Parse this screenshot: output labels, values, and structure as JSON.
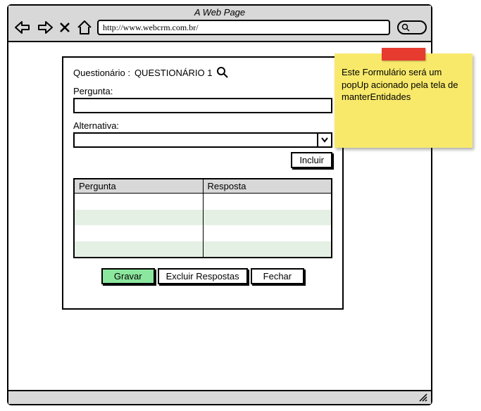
{
  "browser": {
    "page_title": "A Web Page",
    "url": "http://www.webcrm.com.br/"
  },
  "form": {
    "title_prefix": "Questionário : ",
    "title_value": "QUESTIONÁRIO 1",
    "pergunta_label": "Pergunta:",
    "pergunta_value": "",
    "alternativa_label": "Alternativa:",
    "alternativa_value": "",
    "incluir_label": "Incluir",
    "table": {
      "col1_header": "Pergunta",
      "col2_header": "Resposta",
      "rows": []
    },
    "buttons": {
      "gravar": "Gravar",
      "excluir_respostas": "Excluir Respostas",
      "fechar": "Fechar"
    }
  },
  "sticky": {
    "text": "Este Formulário será um popUp acionado pela tela de manterEntidades"
  }
}
